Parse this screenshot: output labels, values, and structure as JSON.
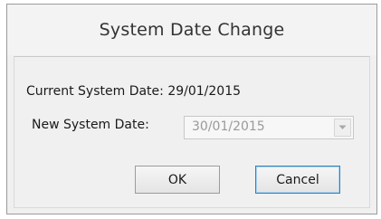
{
  "dialog": {
    "title": "System Date Change"
  },
  "current_date": {
    "text": "Current System Date: 29/01/2015"
  },
  "new_date": {
    "label": "New System Date:",
    "value": "30/01/2015",
    "enabled": false
  },
  "buttons": {
    "ok": "OK",
    "cancel": "Cancel"
  },
  "icons": {
    "dropdown": "chevron-down-icon"
  },
  "colors": {
    "dialog_background": "#f0f0f0",
    "disabled_text": "#9a9a9a",
    "focused_button_border": "#3c7fb1"
  }
}
